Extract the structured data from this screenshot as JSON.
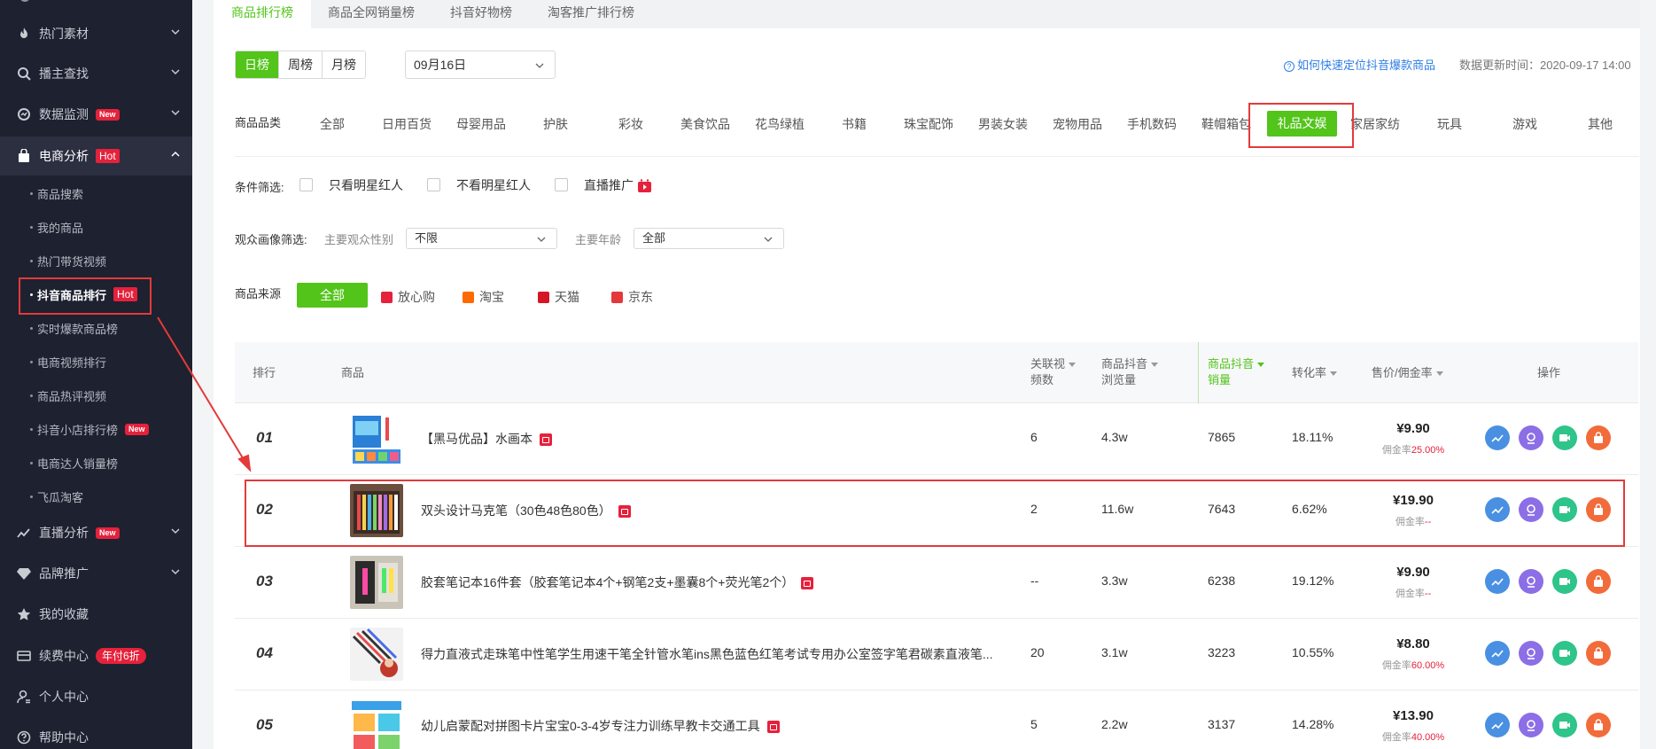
{
  "sidebar": {
    "items": [
      {
        "label": "热门素材",
        "icon": "fire-icon",
        "badge": ""
      },
      {
        "label": "播主查找",
        "icon": "search-icon",
        "badge": ""
      },
      {
        "label": "数据监测",
        "icon": "monitor-icon",
        "badge": "New"
      },
      {
        "label": "电商分析",
        "icon": "shopping-bag-icon",
        "badge": "Hot"
      }
    ],
    "sub_items": [
      "商品搜索",
      "我的商品",
      "热门带货视频",
      "抖音商品排行",
      "实时爆款商品榜",
      "电商视频排行",
      "商品热评视频",
      "抖音小店排行榜",
      "电商达人销量榜",
      "飞瓜淘客"
    ],
    "sub_badges": {
      "current": "Hot",
      "shop_rank": "New"
    },
    "items_bottom": [
      {
        "label": "直播分析",
        "icon": "live-chart-icon",
        "badge": "New"
      },
      {
        "label": "品牌推广",
        "icon": "diamond-icon",
        "badge": ""
      },
      {
        "label": "我的收藏",
        "icon": "star-icon",
        "badge": ""
      },
      {
        "label": "续费中心",
        "icon": "card-icon",
        "badge": "年付6折"
      },
      {
        "label": "个人中心",
        "icon": "user-icon",
        "badge": ""
      },
      {
        "label": "帮助中心",
        "icon": "help-icon",
        "badge": ""
      }
    ]
  },
  "tabs": [
    "商品排行榜",
    "商品全网销量榜",
    "抖音好物榜",
    "淘客推广排行榜"
  ],
  "period": {
    "options": [
      "日榜",
      "周榜",
      "月榜"
    ],
    "selected": "日榜",
    "date": "09月16日"
  },
  "help_link": "如何快速定位抖音爆款商品",
  "update_time": "数据更新时间：2020-09-17 14:00",
  "category": {
    "label": "商品品类",
    "options": [
      "全部",
      "日用百货",
      "母婴用品",
      "护肤",
      "彩妆",
      "美食饮品",
      "花鸟绿植",
      "书籍",
      "珠宝配饰",
      "男装女装",
      "宠物用品",
      "手机数码",
      "鞋帽箱包",
      "礼品文娱",
      "家居家纺",
      "玩具",
      "游戏",
      "其他"
    ],
    "selected": "礼品文娱"
  },
  "conditions": {
    "label": "条件筛选:",
    "options": [
      "只看明星红人",
      "不看明星红人",
      "直播推广"
    ]
  },
  "audience": {
    "label": "观众画像筛选:",
    "gender_label": "主要观众性别",
    "gender_value": "不限",
    "age_label": "主要年龄",
    "age_value": "全部"
  },
  "source": {
    "label": "商品来源",
    "selected": "全部",
    "options": [
      {
        "label": "放心购",
        "color": "#e5213b"
      },
      {
        "label": "淘宝",
        "color": "#ff6a00"
      },
      {
        "label": "天猫",
        "color": "#d41626"
      },
      {
        "label": "京东",
        "color": "#e4393c"
      }
    ]
  },
  "table": {
    "headers": {
      "rank": "排行",
      "product": "商品",
      "videos": [
        "关联视",
        "频数"
      ],
      "views": [
        "商品抖音",
        "浏览量"
      ],
      "sales": [
        "商品抖音",
        "销量"
      ],
      "conversion": "转化率",
      "price": "售价/佣金率",
      "ops": "操作"
    },
    "commission_label": "佣金率",
    "rows": [
      {
        "rank": "01",
        "name": "【黑马优品】水画本",
        "videos": "6",
        "views": "4.3w",
        "sales": "7865",
        "conversion": "18.11%",
        "price": "¥9.90",
        "commission": "25.00%"
      },
      {
        "rank": "02",
        "name": "双头设计马克笔（30色48色80色）",
        "videos": "2",
        "views": "11.6w",
        "sales": "7643",
        "conversion": "6.62%",
        "price": "¥19.90",
        "commission": "--"
      },
      {
        "rank": "03",
        "name": "胶套笔记本16件套（胶套笔记本4个+钢笔2支+墨囊8个+荧光笔2个）",
        "videos": "--",
        "views": "3.3w",
        "sales": "6238",
        "conversion": "19.12%",
        "price": "¥9.90",
        "commission": "--"
      },
      {
        "rank": "04",
        "name": "得力直液式走珠笔中性笔学生用速干笔全针管水笔ins黑色蓝色红笔考试专用办公室签字笔君碳素直液笔...",
        "videos": "20",
        "views": "3.1w",
        "sales": "3223",
        "conversion": "10.55%",
        "price": "¥8.80",
        "commission": "60.00%"
      },
      {
        "rank": "05",
        "name": "幼儿启蒙配对拼图卡片宝宝0-3-4岁专注力训练早教卡交通工具",
        "videos": "5",
        "views": "2.2w",
        "sales": "3137",
        "conversion": "14.28%",
        "price": "¥13.90",
        "commission": "40.00%"
      }
    ]
  },
  "colors": {
    "accent": "#52c41a",
    "sidebar_bg": "#1e2130",
    "highlight": "#e33a3a",
    "link": "#2f7ee6"
  }
}
